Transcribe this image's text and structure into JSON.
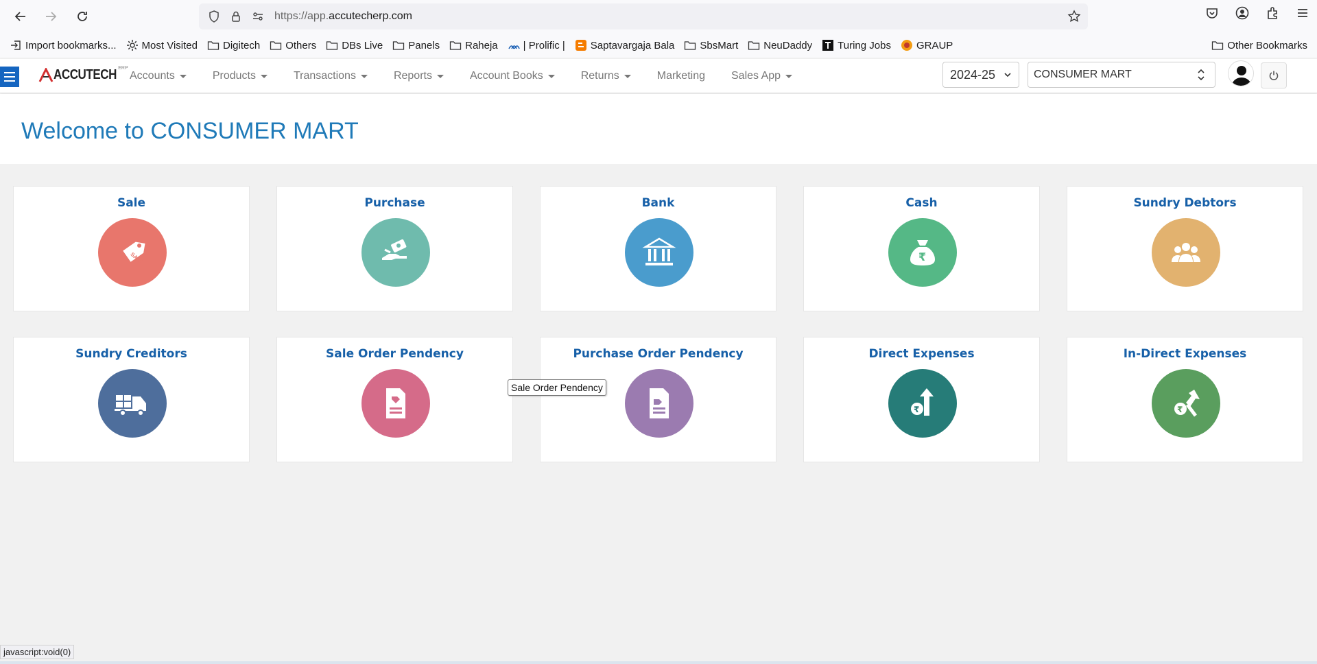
{
  "browser": {
    "url_prefix": "https://app.",
    "url_domain": "accutecherp.com",
    "bookmarks": [
      {
        "label": "Import bookmarks...",
        "icon": "import-icon"
      },
      {
        "label": "Most Visited",
        "icon": "gear-icon"
      },
      {
        "label": "Digitech",
        "icon": "folder-icon"
      },
      {
        "label": "Others",
        "icon": "folder-icon"
      },
      {
        "label": "DBs Live",
        "icon": "folder-icon"
      },
      {
        "label": "Panels",
        "icon": "folder-icon"
      },
      {
        "label": "Raheja",
        "icon": "folder-icon"
      },
      {
        "label": "| Prolific |",
        "icon": "prolific-icon"
      },
      {
        "label": "Saptavargaja Bala",
        "icon": "blogger-icon"
      },
      {
        "label": "SbsMart",
        "icon": "folder-icon"
      },
      {
        "label": "NeuDaddy",
        "icon": "folder-icon"
      },
      {
        "label": "Turing Jobs",
        "icon": "turing-icon"
      },
      {
        "label": "GRAUP",
        "icon": "graup-icon"
      }
    ],
    "other_bookmarks": "Other Bookmarks"
  },
  "app": {
    "logo": "ACCUTECH",
    "logo_sup": "ERP",
    "menu": [
      {
        "label": "Accounts",
        "dropdown": true
      },
      {
        "label": "Products",
        "dropdown": true
      },
      {
        "label": "Transactions",
        "dropdown": true
      },
      {
        "label": "Reports",
        "dropdown": true
      },
      {
        "label": "Account Books",
        "dropdown": true
      },
      {
        "label": "Returns",
        "dropdown": true
      },
      {
        "label": "Marketing",
        "dropdown": false
      },
      {
        "label": "Sales App",
        "dropdown": true
      }
    ],
    "year": "2024-25",
    "company": "CONSUMER MART"
  },
  "welcome": "Welcome to CONSUMER MART",
  "cards": [
    {
      "title": "Sale",
      "icon": "sale-tag-icon",
      "color": "#e8766c"
    },
    {
      "title": "Purchase",
      "icon": "purchase-hand-icon",
      "color": "#6fbbad"
    },
    {
      "title": "Bank",
      "icon": "bank-icon",
      "color": "#4a9ccd"
    },
    {
      "title": "Cash",
      "icon": "money-bag-icon",
      "color": "#55b886"
    },
    {
      "title": "Sundry Debtors",
      "icon": "group-icon",
      "color": "#e2b26f"
    },
    {
      "title": "Sundry Creditors",
      "icon": "truck-icon",
      "color": "#4e6e9c"
    },
    {
      "title": "Sale Order Pendency",
      "icon": "sale-order-icon",
      "color": "#d56b89"
    },
    {
      "title": "Purchase Order Pendency",
      "icon": "purchase-order-icon",
      "color": "#9b7bb0"
    },
    {
      "title": "Direct Expenses",
      "icon": "direct-expense-icon",
      "color": "#267c78"
    },
    {
      "title": "In-Direct Expenses",
      "icon": "indirect-expense-icon",
      "color": "#5a9e5e"
    }
  ],
  "tooltip": "Sale Order Pendency",
  "status_bar": "javascript:void(0)"
}
